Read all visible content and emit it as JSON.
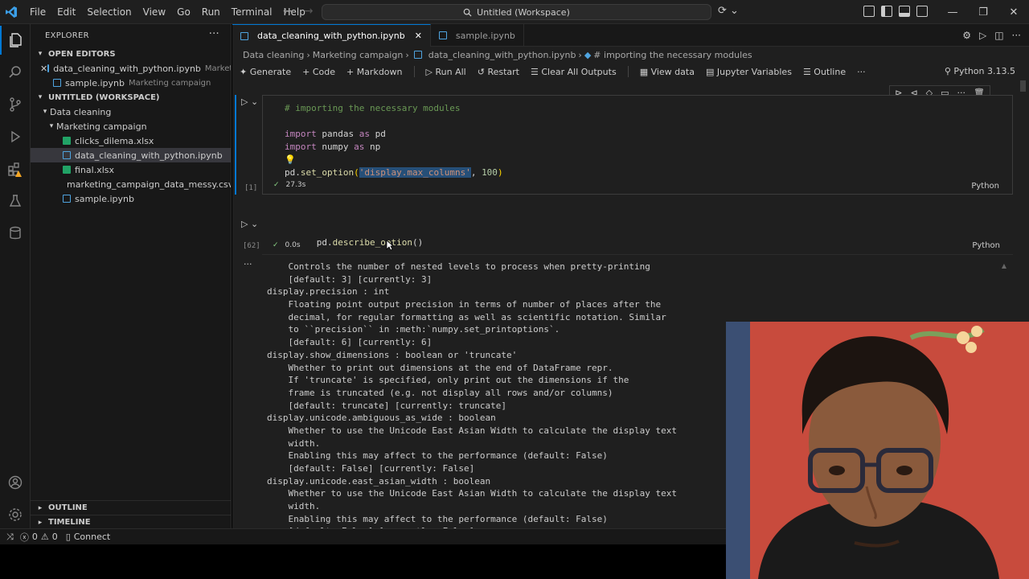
{
  "titlebar": {
    "menu": [
      "File",
      "Edit",
      "Selection",
      "View",
      "Go",
      "Run",
      "Terminal",
      "Help"
    ],
    "search_text": "Untitled (Workspace)"
  },
  "sidebar": {
    "title": "EXPLORER",
    "open_editors_label": "OPEN EDITORS",
    "open_editors": [
      {
        "name": "data_cleaning_with_python.ipynb",
        "desc": "Marketi...",
        "type": "notebook"
      },
      {
        "name": "sample.ipynb",
        "desc": "Marketing campaign",
        "type": "notebook"
      }
    ],
    "workspace_label": "UNTITLED (WORKSPACE)",
    "folder_root": "Data cleaning",
    "folder_sub": "Marketing campaign",
    "files": [
      {
        "name": "clicks_dilema.xlsx",
        "type": "excel"
      },
      {
        "name": "data_cleaning_with_python.ipynb",
        "type": "notebook"
      },
      {
        "name": "final.xlsx",
        "type": "excel"
      },
      {
        "name": "marketing_campaign_data_messy.csv",
        "type": "csv"
      },
      {
        "name": "sample.ipynb",
        "type": "notebook"
      }
    ],
    "outline_label": "OUTLINE",
    "timeline_label": "TIMELINE"
  },
  "tabs": [
    {
      "label": "data_cleaning_with_python.ipynb",
      "active": true
    },
    {
      "label": "sample.ipynb",
      "active": false
    }
  ],
  "breadcrumb": [
    "Data cleaning",
    "Marketing campaign",
    "data_cleaning_with_python.ipynb",
    "# importing the necessary modules"
  ],
  "toolbar": {
    "generate": "Generate",
    "code": "Code",
    "markdown": "Markdown",
    "run_all": "Run All",
    "restart": "Restart",
    "clear_outputs": "Clear All Outputs",
    "view_data": "View data",
    "jupyter_vars": "Jupyter Variables",
    "outline": "Outline",
    "kernel": "Python 3.13.5"
  },
  "cell1": {
    "exec_count": "[1]",
    "time": "27.3s",
    "lang": "Python",
    "comment": "# importing the necessary modules",
    "l1_kw": "import",
    "l1_mod": "pandas",
    "l1_as": "as",
    "l1_alias": "pd",
    "l2_kw": "import",
    "l2_mod": "numpy",
    "l2_as": "as",
    "l2_alias": "np",
    "l3_obj": "pd.",
    "l3_fn": "set_option",
    "l3_open": "(",
    "l3_str": "'display.max_columns'",
    "l3_sep": ", ",
    "l3_num": "100",
    "l3_close": ")"
  },
  "cell2": {
    "exec_count": "[62]",
    "time": "0.0s",
    "lang": "Python",
    "obj": "pd.",
    "fn": "describe_option",
    "args": "()"
  },
  "output_lines": [
    "    Controls the number of nested levels to process when pretty-printing",
    "    [default: 3] [currently: 3]",
    "display.precision : int",
    "    Floating point output precision in terms of number of places after the",
    "    decimal, for regular formatting as well as scientific notation. Similar",
    "    to ``precision`` in :meth:`numpy.set_printoptions`.",
    "    [default: 6] [currently: 6]",
    "display.show_dimensions : boolean or 'truncate'",
    "    Whether to print out dimensions at the end of DataFrame repr.",
    "    If 'truncate' is specified, only print out the dimensions if the",
    "    frame is truncated (e.g. not display all rows and/or columns)",
    "    [default: truncate] [currently: truncate]",
    "display.unicode.ambiguous_as_wide : boolean",
    "    Whether to use the Unicode East Asian Width to calculate the display text",
    "    width.",
    "    Enabling this may affect to the performance (default: False)",
    "    [default: False] [currently: False]",
    "display.unicode.east_asian_width : boolean",
    "    Whether to use the Unicode East Asian Width to calculate the display text",
    "    width.",
    "    Enabling this may affect to the performance (default: False)",
    "    [default: False] [currently: False]"
  ],
  "statusbar": {
    "errors": "0",
    "warnings": "0",
    "connect": "Connect"
  },
  "colors": {
    "accent": "#0078d4",
    "success": "#89d185",
    "warning_badge": "#f5a623"
  }
}
